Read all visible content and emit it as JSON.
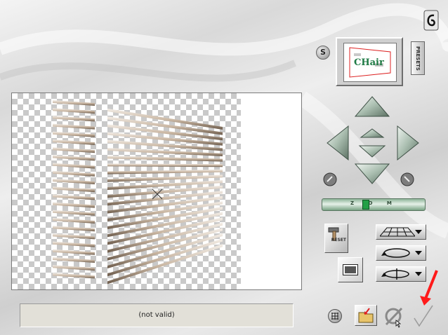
{
  "status": {
    "text": "(not valid)"
  },
  "preset": {
    "thumb_text": "CHair",
    "s_label": "S",
    "presets_label": "PRESETS"
  },
  "controls": {
    "reset_label": "RESET",
    "zoom_label": "Z O M"
  },
  "icons": {
    "logo": "swirl-logo-icon",
    "grid": "grid-icon",
    "folder": "folder-icon",
    "cancel": "cancel-icon",
    "ok": "checkmark-icon",
    "move_up": "arrow-up-icon",
    "move_down": "arrow-down-icon",
    "move_left": "arrow-left-icon",
    "move_right": "arrow-right-icon",
    "rotate_left": "rotate-left-icon",
    "rotate_right": "rotate-right-icon",
    "perspective": "perspective-grid-icon",
    "rotation": "circle-arrow-icon",
    "flip": "flip-rotate-icon",
    "reset": "hammer-icon"
  },
  "colors": {
    "accent_red": "#ff1a1a",
    "zoom_green": "#22a046"
  }
}
